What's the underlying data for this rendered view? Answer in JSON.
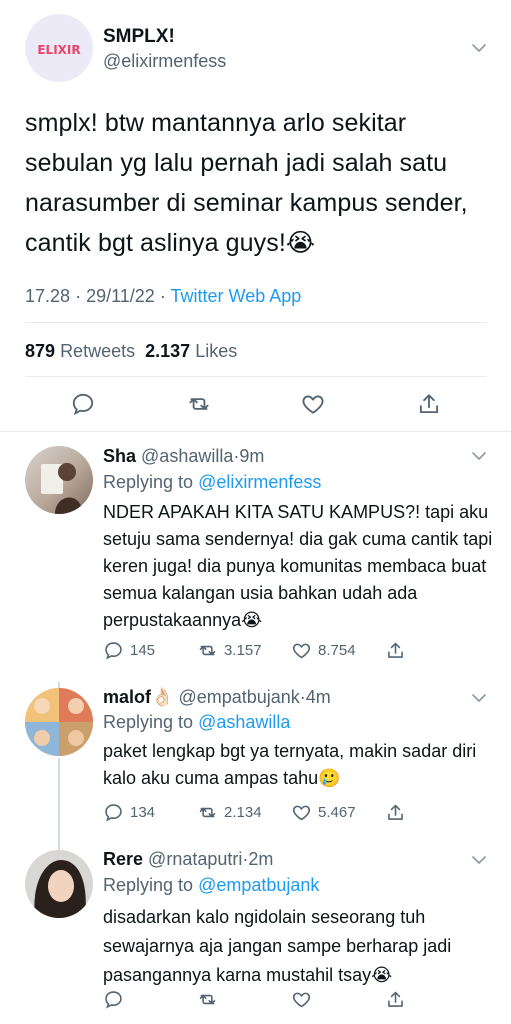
{
  "main_tweet": {
    "avatar_logo_text": "ELIXIR",
    "display_name": "SMPLX!",
    "handle": "@elixirmenfess",
    "text": "smplx! btw mantannya arlo sekitar sebulan yg lalu pernah jadi salah satu narasumber di seminar kampus sender, cantik bgt aslinya guys!😭",
    "time": "17.28",
    "date": "29/11/22",
    "source": "Twitter Web App",
    "retweets_count": "879",
    "retweets_label": "Retweets",
    "likes_count": "2.137",
    "likes_label": "Likes"
  },
  "replies": [
    {
      "name": "Sha",
      "handle": "@ashawilla",
      "time": "9m",
      "replying_to_label": "Replying to",
      "replying_to": "@elixirmenfess",
      "text": "NDER APAKAH KITA SATU KAMPUS?! tapi aku setuju sama sendernya! dia gak cuma cantik tapi keren juga! dia punya komunitas membaca buat semua kalangan usia bahkan udah ada perpustakaannya😭",
      "replies_count": "145",
      "retweets_count": "3.157",
      "likes_count": "8.754"
    },
    {
      "name": "malof👌🏻",
      "handle": "@empatbujank",
      "time": "4m",
      "replying_to_label": "Replying to",
      "replying_to": "@ashawilla",
      "text": "paket lengkap bgt ya ternyata, makin sadar diri kalo aku cuma ampas tahu🥲",
      "replies_count": "134",
      "retweets_count": "2.134",
      "likes_count": "5.467"
    },
    {
      "name": "Rere",
      "handle": "@rnataputri",
      "time": "2m",
      "replying_to_label": "Replying to",
      "replying_to": "@empatbujank",
      "text": "disadarkan kalo ngidolain seseorang tuh sewajarnya aja jangan sampe berharap jadi pasangannya karna mustahil tsay😭",
      "replies_count": "",
      "retweets_count": "",
      "likes_count": ""
    }
  ],
  "colors": {
    "link": "#1d9bf0",
    "secondary_text": "#536471",
    "primary_text": "#0f1419",
    "divider": "#e6ecf0"
  }
}
